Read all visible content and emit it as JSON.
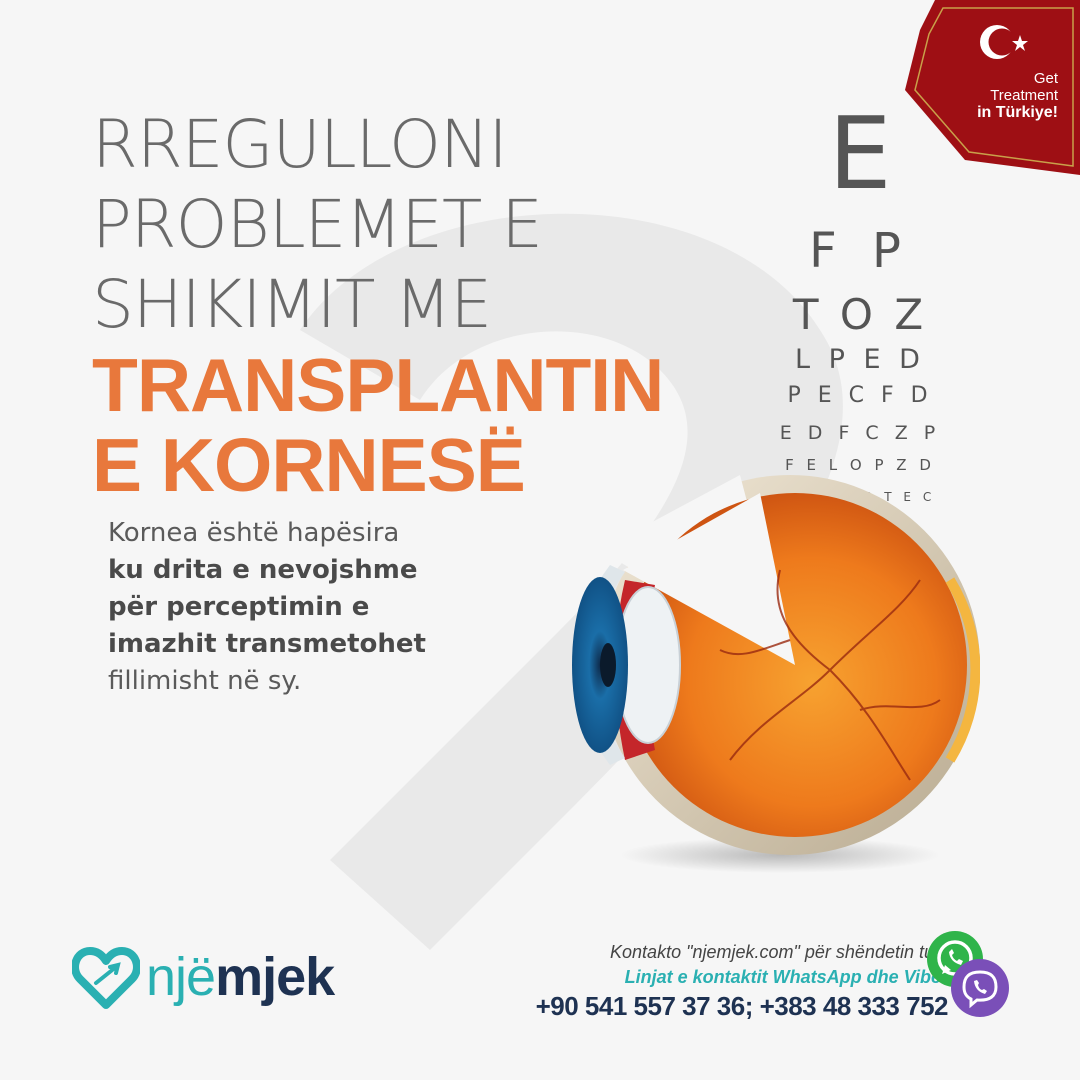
{
  "headline": {
    "line1": "RREGULLONI",
    "line2": "PROBLEMET E",
    "line3": "SHIKIMIT ME",
    "highlight1": "TRANSPLANTIN",
    "highlight2": "E KORNESË"
  },
  "description": {
    "line1": "Kornea është hapësira",
    "line2": "ku drita e nevojshme",
    "line3": "për perceptimin e",
    "line4": "imazhit transmetohet",
    "line5": "fillimisht në sy."
  },
  "eye_chart": {
    "rows": [
      "E",
      "F P",
      "T O Z",
      "L P E D",
      "P E C F D",
      "E D F C Z P",
      "F E L O P Z D",
      "D E F P O T E C"
    ]
  },
  "badge": {
    "line1": "Get",
    "line2": "Treatment",
    "line3": "in Türkiye!"
  },
  "logo": {
    "part1": "një",
    "part2": "mjek"
  },
  "contact": {
    "line1": "Kontakto \"njemjek.com\" për shëndetin tuaj",
    "line2": "Linjat e kontaktit WhatsApp dhe Viber",
    "phones": "+90 541 557 37 36; +383 48 333 752"
  },
  "icons": {
    "whatsapp": "whatsapp-icon",
    "viber": "viber-icon",
    "logo": "heart-plane-logo-icon",
    "flag": "turkish-crescent-star-icon",
    "eye": "eye-anatomy-illustration"
  },
  "colors": {
    "accent": "#e8783c",
    "navy": "#1e3252",
    "teal": "#2ab0b2",
    "badge_red": "#9e0f14"
  }
}
